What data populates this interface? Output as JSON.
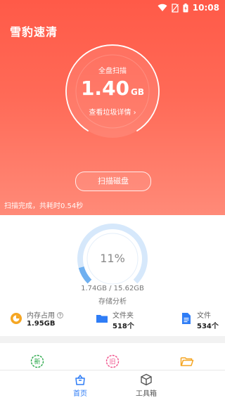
{
  "status_bar": {
    "time": "10:08"
  },
  "app": {
    "title": "雪豹速清"
  },
  "disk": {
    "label": "全盘扫描",
    "value": "1.40",
    "unit": "GB",
    "detail_link": "查看垃圾详情 ›"
  },
  "scan": {
    "button_label": "扫描磁盘",
    "status_text": "扫描完成，共耗时0.54秒"
  },
  "storage": {
    "percent_text": "11%",
    "percent_value": 11,
    "size_text": "1.74GB / 15.62GB",
    "label": "存储分析"
  },
  "stats": [
    {
      "title": "内存占用",
      "value": "1.95GB"
    },
    {
      "title": "文件夹",
      "value": "518个"
    },
    {
      "title": "文件",
      "value": "534个"
    }
  ],
  "tools": [
    {
      "glyph": "新"
    },
    {
      "glyph": "旧"
    }
  ],
  "nav": {
    "home_label": "首页",
    "tools_label": "工具箱"
  },
  "colors": {
    "brand_red": "#ff5a48",
    "accent_blue": "#2f7df6",
    "gauge_blue": "#6fb0f0",
    "new_green": "#2aa84a",
    "old_pink": "#f0508a",
    "folder_orange": "#f5a623"
  }
}
